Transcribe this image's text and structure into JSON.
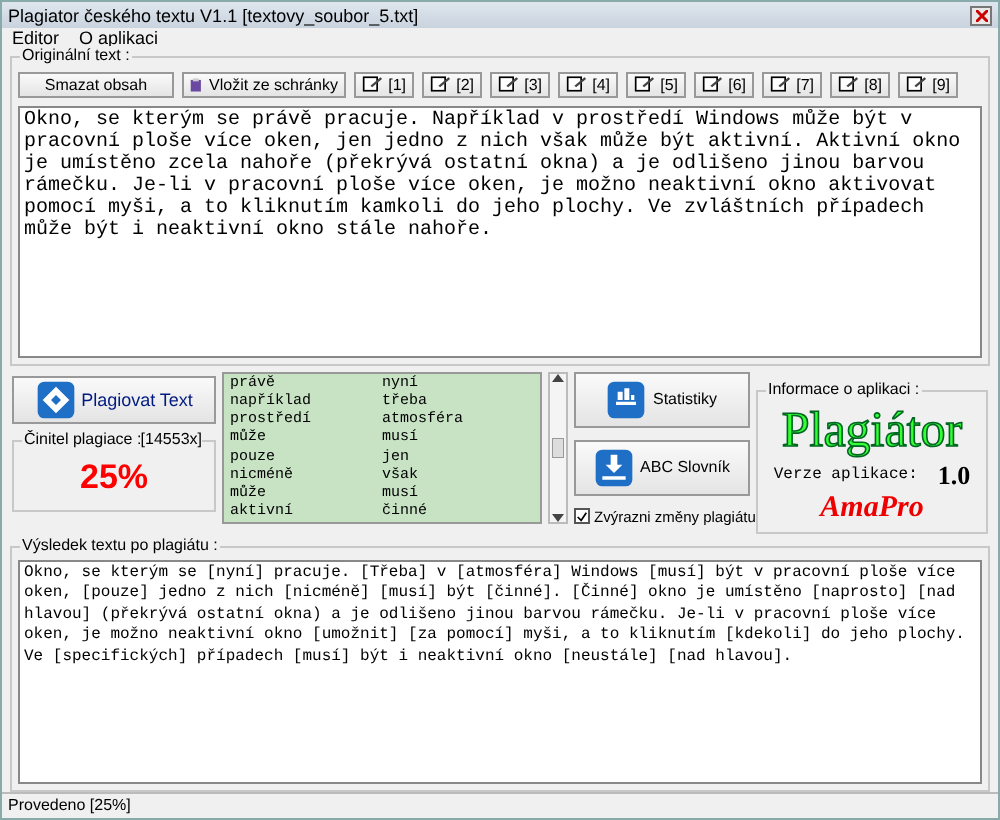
{
  "window": {
    "title": "Plagiator českého textu V1.1   [textovy_soubor_5.txt]"
  },
  "menu": [
    {
      "label": "Editor"
    },
    {
      "label": "O aplikaci"
    }
  ],
  "original": {
    "label": "Originální text :",
    "buttons": [
      "Smazat obsah",
      "Vložit ze schránky"
    ],
    "slots": [
      "[1]",
      "[2]",
      "[3]",
      "[4]",
      "[5]",
      "[6]",
      "[7]",
      "[8]",
      "[9]"
    ],
    "text": "Okno, se kterým se právě pracuje. Například v prostředí Windows může být v pracovní ploše více oken, jen jedno z nich však může být aktivní. Aktivní okno je umístěno zcela nahoře (překrývá ostatní okna) a je odlišeno jinou barvou rámečku. Je-li v pracovní ploše více oken, je možno neaktivní okno aktivovat pomocí myši, a to kliknutím kamkoli do jeho plochy. Ve zvláštních případech může být i neaktivní okno stále nahoře."
  },
  "plagiate_button": "Plagiovat Text",
  "factor": {
    "label": "Činitel plagiace :",
    "count": "[14553x]",
    "value": "25%"
  },
  "word_pairs": [
    [
      "právě",
      "nyní"
    ],
    [
      "například",
      "třeba"
    ],
    [
      "prostředí",
      "atmosféra"
    ],
    [
      "může",
      "musí"
    ],
    [
      "pouze",
      "jen"
    ],
    [
      "nicméně",
      "však"
    ],
    [
      "může",
      "musí"
    ],
    [
      "aktivní",
      "činné"
    ]
  ],
  "tools": [
    {
      "label": "Statistiky",
      "kind": "chart"
    },
    {
      "label": "ABC Slovník",
      "kind": "download"
    }
  ],
  "highlight": {
    "label": "Zvýrazni změny plagiátu",
    "checked": true
  },
  "info": {
    "label": "Informace o aplikaci :",
    "logo": "Plagiátor",
    "version_label": "Verze aplikace:",
    "version": "1.0",
    "author": "AmaPro"
  },
  "result": {
    "label": "Výsledek textu po plagiátu :",
    "text": "Okno, se kterým se [nyní] pracuje. [Třeba] v [atmosféra] Windows [musí] být v pracovní ploše více oken, [pouze] jedno z nich [nicméně] [musí] být [činné]. [Činné] okno je umístěno [naprosto] [nad hlavou] (překrývá ostatní okna) a je odlišeno jinou barvou rámečku. Je-li v pracovní ploše více oken, je možno neaktivní okno [umožnit] [za pomocí] myši, a to kliknutím [kdekoli] do jeho plochy. Ve [specifických] případech [musí] být i neaktivní okno [neustále] [nad hlavou]."
  },
  "status_bar": "Provedeno [25%]"
}
